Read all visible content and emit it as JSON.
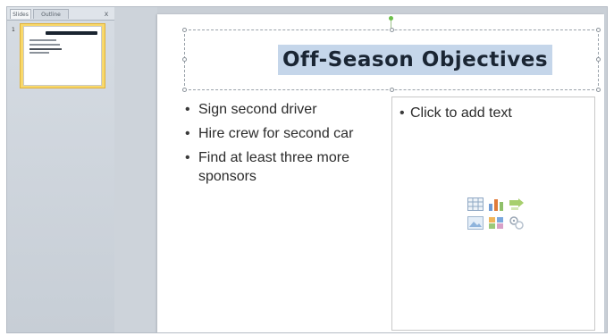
{
  "left_pane": {
    "tabs": [
      {
        "label": "Slides"
      },
      {
        "label": "Outline"
      }
    ],
    "close_label": "x",
    "slide_number": "1"
  },
  "slide": {
    "title": "Off-Season Objectives",
    "bullets": [
      "Sign second driver",
      "Hire crew for second car",
      "Find at least three more sponsors"
    ],
    "placeholder": "Click to add text",
    "insert_icons": [
      "insert-table-icon",
      "insert-chart-icon",
      "insert-smartart-icon",
      "insert-picture-icon",
      "insert-clipart-icon",
      "insert-media-icon"
    ]
  },
  "colors": {
    "title_highlight": "#c5d6ea",
    "thumbnail_selected": "#f8d86b",
    "rotation_handle": "#6cbf4a"
  }
}
